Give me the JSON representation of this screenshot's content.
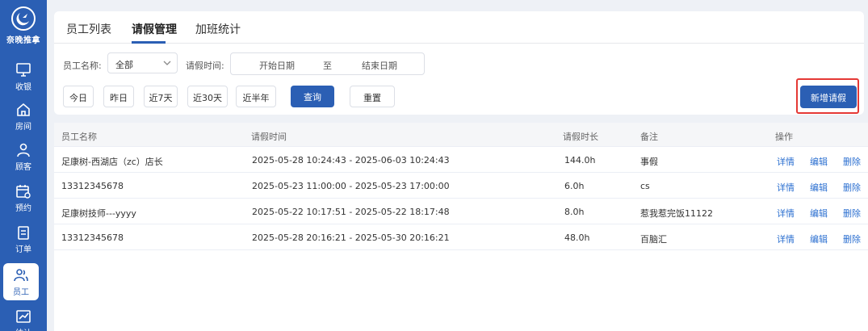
{
  "brand": {
    "name": "奈晚推拿"
  },
  "sidebar": {
    "items": [
      {
        "label": "收银",
        "icon": "monitor-icon"
      },
      {
        "label": "房间",
        "icon": "home-icon"
      },
      {
        "label": "顾客",
        "icon": "user-icon"
      },
      {
        "label": "预约",
        "icon": "calendar-icon"
      },
      {
        "label": "订单",
        "icon": "clipboard-icon"
      },
      {
        "label": "员工",
        "icon": "staff-icon",
        "active": true
      },
      {
        "label": "统计",
        "icon": "chart-icon"
      }
    ]
  },
  "tabs": [
    {
      "label": "员工列表"
    },
    {
      "label": "请假管理",
      "active": true
    },
    {
      "label": "加班统计"
    }
  ],
  "filters": {
    "employee_label": "员工名称:",
    "employee_value": "全部",
    "time_label": "请假时间:",
    "start_placeholder": "开始日期",
    "range_sep": "至",
    "end_placeholder": "结束日期"
  },
  "quick_buttons": [
    "今日",
    "昨日",
    "近7天",
    "近30天",
    "近半年"
  ],
  "actions": {
    "query": "查询",
    "reset": "重置",
    "add": "新增请假"
  },
  "table": {
    "headers": [
      "员工名称",
      "请假时间",
      "请假时长",
      "备注",
      "操作"
    ],
    "rows": [
      {
        "name": "足康树-西湖店（zc）店长",
        "time": "2025-05-28 10:24:43 - 2025-06-03 10:24:43",
        "duration": "144.0h",
        "note": "事假"
      },
      {
        "name": "13312345678",
        "time": "2025-05-23 11:00:00 - 2025-05-23 17:00:00",
        "duration": "6.0h",
        "note": "cs"
      },
      {
        "name": "足康树技师---yyyy",
        "time": "2025-05-22 10:17:51 - 2025-05-22 18:17:48",
        "duration": "8.0h",
        "note": "惹我惹完饭11122"
      },
      {
        "name": "13312345678",
        "time": "2025-05-28 20:16:21 - 2025-05-30 20:16:21",
        "duration": "48.0h",
        "note": "百脑汇"
      }
    ],
    "ops": {
      "detail": "详情",
      "edit": "编辑",
      "delete": "删除"
    }
  },
  "colors": {
    "primary": "#2b5fb4",
    "link": "#2b6fd0",
    "highlight": "#e53935"
  }
}
